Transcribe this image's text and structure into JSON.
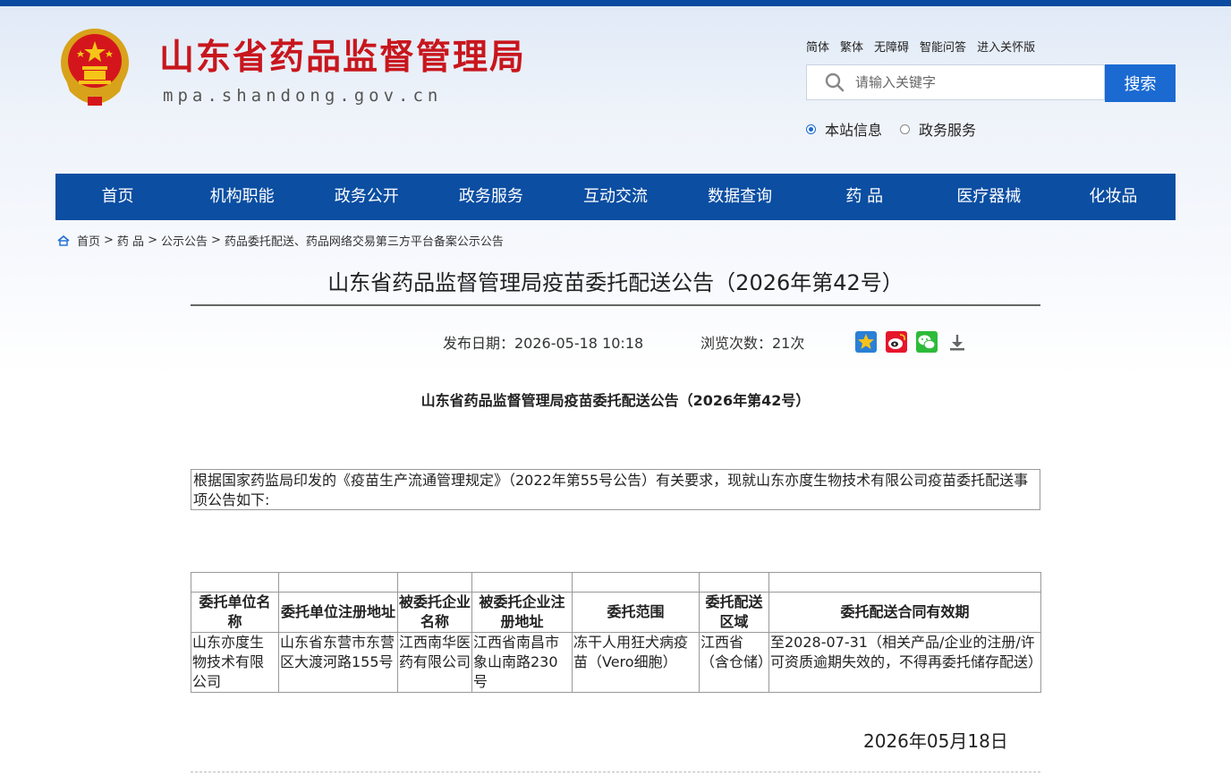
{
  "site": {
    "title": "山东省药品监督管理局",
    "domain": "mpa.shandong.gov.cn",
    "colors": {
      "brand_red": "#c8161d",
      "nav_blue": "#0b4ea2",
      "button_blue": "#1a6ad2"
    }
  },
  "toplinks": [
    "简体",
    "繁体",
    "无障碍",
    "智能问答",
    "进入关怀版"
  ],
  "search": {
    "placeholder": "请输入关键字",
    "button_label": "搜索",
    "scopes": [
      {
        "label": "本站信息",
        "selected": true
      },
      {
        "label": "政务服务",
        "selected": false
      }
    ]
  },
  "nav": [
    "首页",
    "机构职能",
    "政务公开",
    "政务服务",
    "互动交流",
    "数据查询",
    "药 品",
    "医疗器械",
    "化妆品"
  ],
  "breadcrumb": {
    "home_icon": "home-icon",
    "items": [
      "首页",
      "药 品",
      "公示公告",
      "药品委托配送、药品网络交易第三方平台备案公示公告"
    ],
    "separator": ">"
  },
  "article": {
    "title": "山东省药品监督管理局疫苗委托配送公告（2026年第42号）",
    "publish": "发布日期：2026-05-18 10:18",
    "views": "浏览次数：21次",
    "share_icons": [
      "favorite-icon",
      "weibo-icon",
      "wechat-icon",
      "download-icon"
    ],
    "heading": "山东省药品监督管理局疫苗委托配送公告（2026年第42号）",
    "intro": "根据国家药监局印发的《疫苗生产流通管理规定》（2022年第55号公告）有关要求，现就山东亦度生物技术有限公司疫苗委托配送事项公告如下:",
    "table": {
      "headers": [
        "委托单位名称",
        "委托单位注册地址",
        "被委托企业名称",
        "被委托企业注册地址",
        "委托范围",
        "委托配送区域",
        "委托配送合同有效期"
      ],
      "rows": [
        [
          "山东亦度生物技术有限公司",
          "山东省东营市东营区大渡河路155号",
          "江西南华医药有限公司",
          "江西省南昌市象山南路230号",
          "冻干人用狂犬病疫苗（Vero细胞）",
          "江西省（含仓储）",
          "至2028-07-31（相关产品/企业的注册/许可资质逾期失效的，不得再委托储存配送）"
        ]
      ]
    },
    "sign_date": "2026年05月18日"
  }
}
